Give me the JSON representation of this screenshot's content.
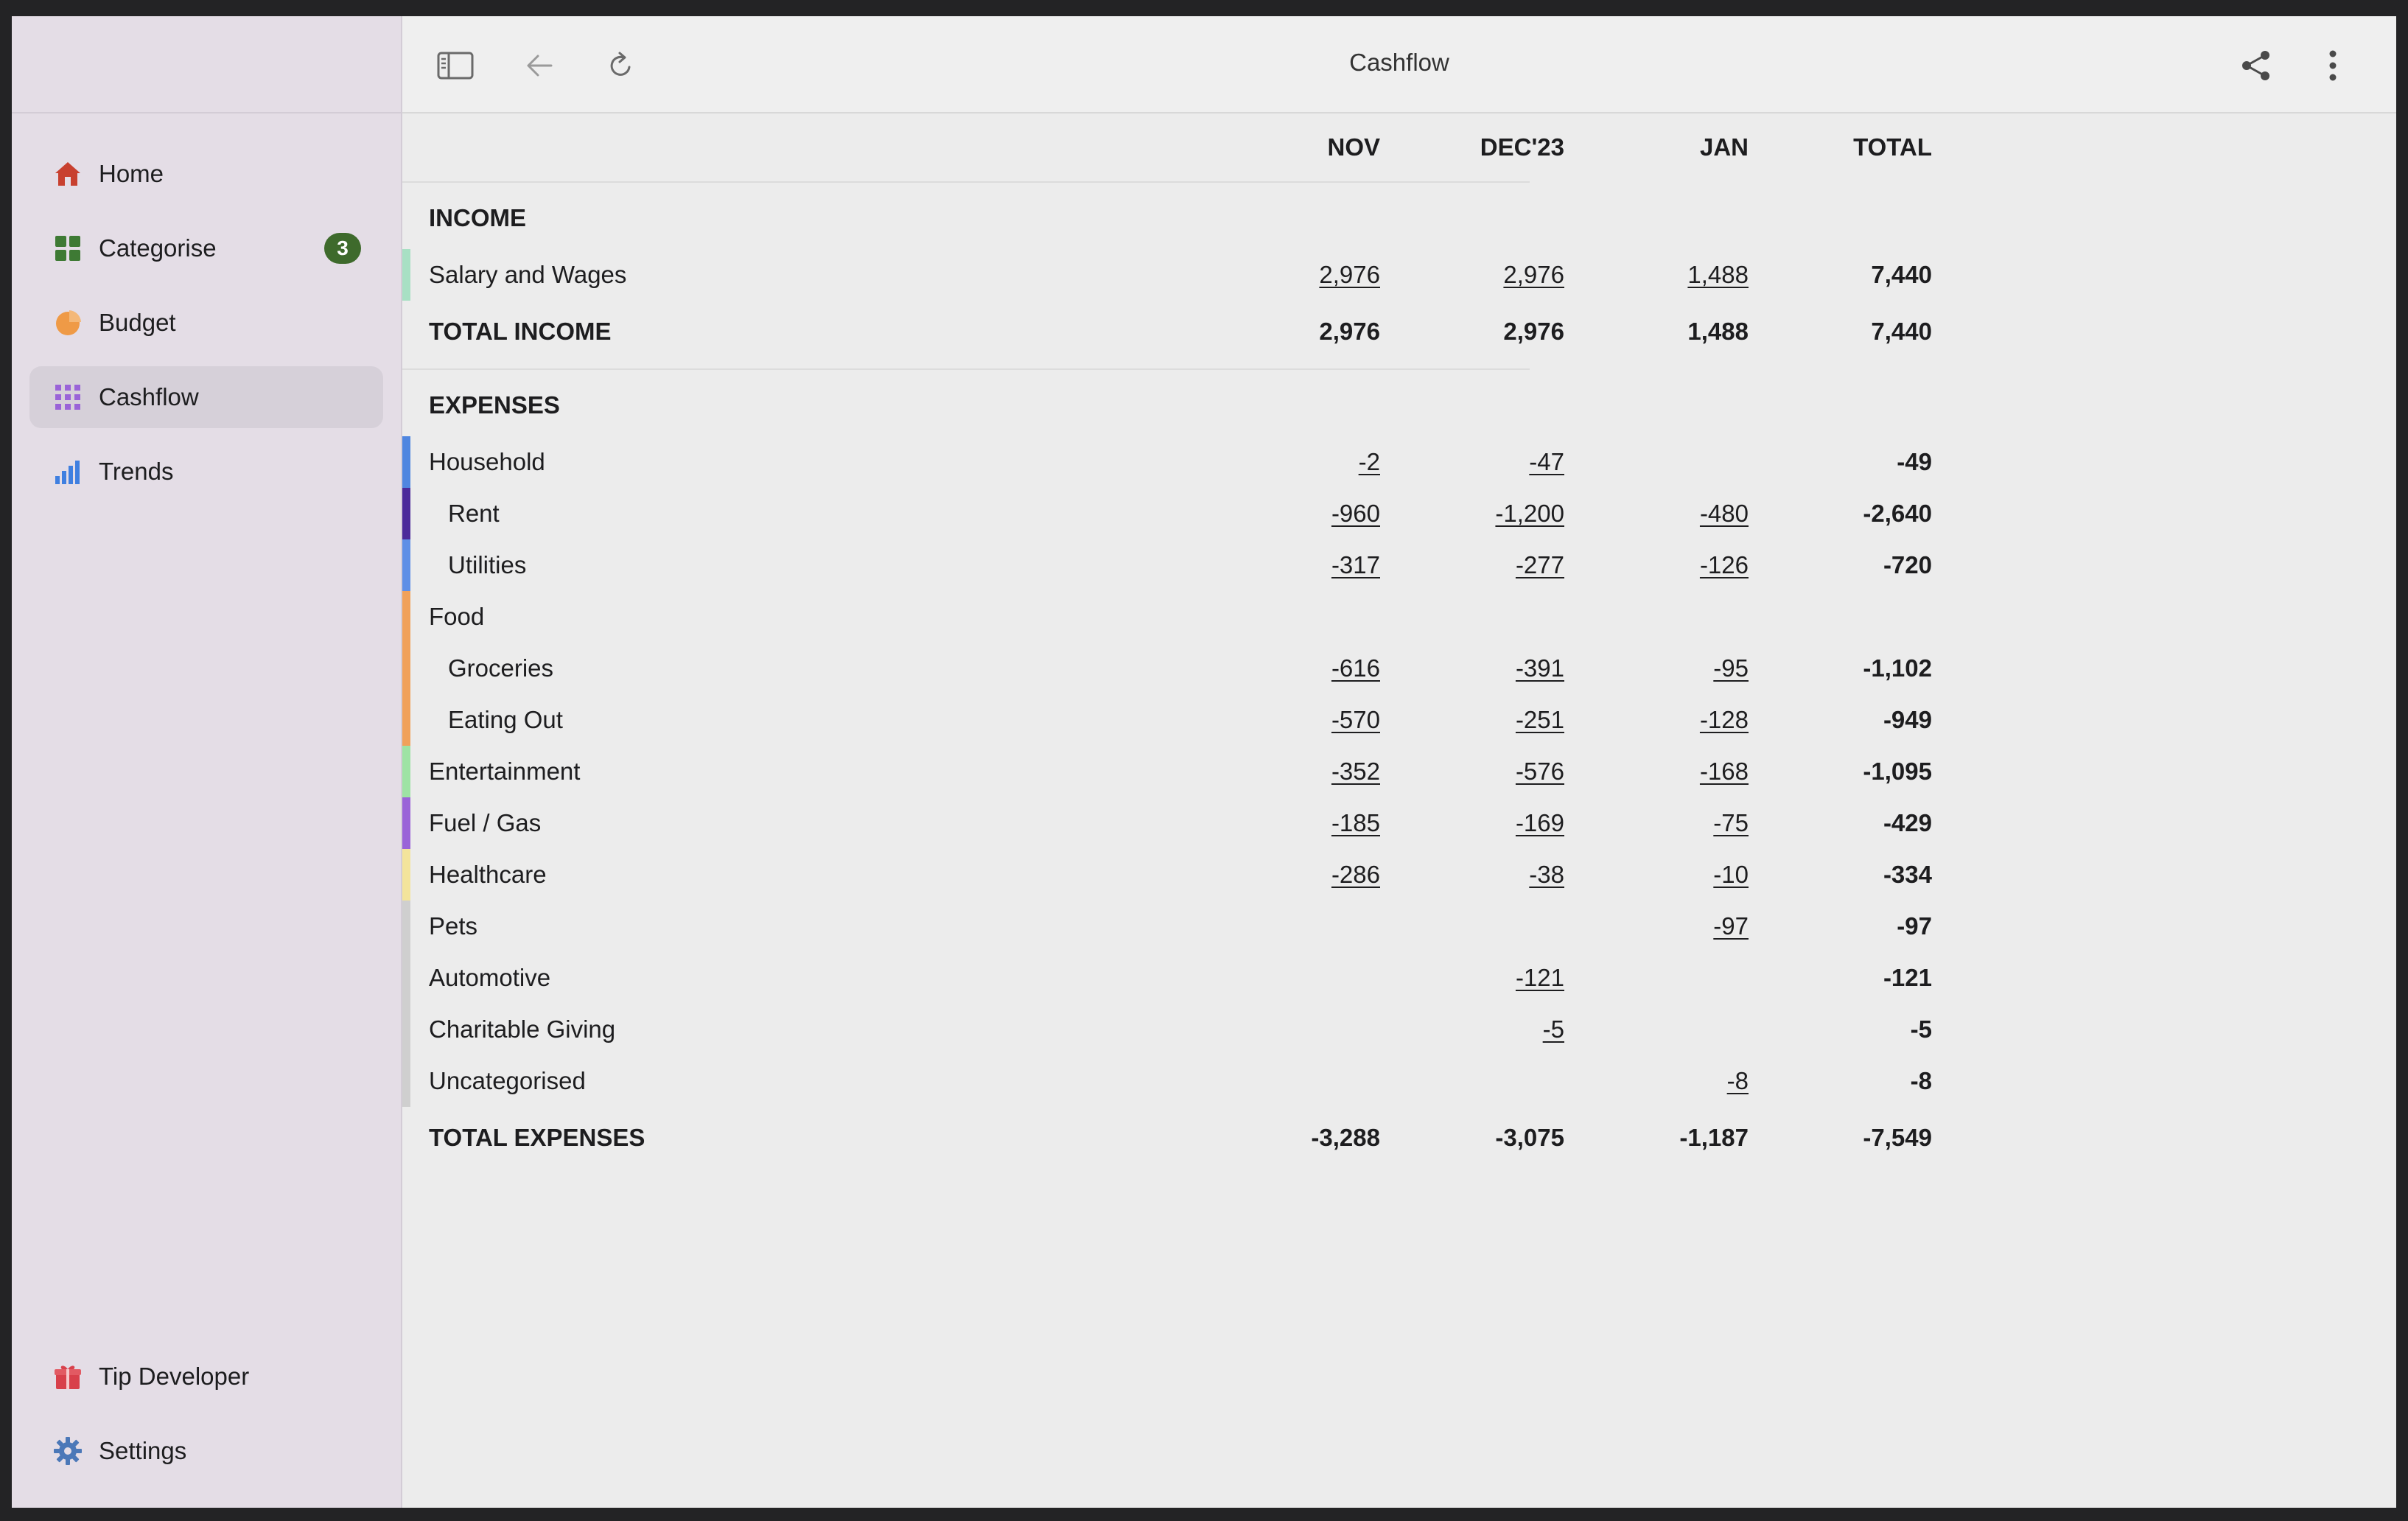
{
  "app": {
    "title": "Cashflow"
  },
  "sidebar": {
    "items": [
      {
        "label": "Home",
        "icon": "house-icon"
      },
      {
        "label": "Categorise",
        "icon": "grid-icon",
        "badge": "3"
      },
      {
        "label": "Budget",
        "icon": "pie-chart-icon"
      },
      {
        "label": "Cashflow",
        "icon": "dot-grid-icon",
        "active": true
      },
      {
        "label": "Trends",
        "icon": "bar-chart-icon"
      }
    ],
    "footer": [
      {
        "label": "Tip Developer",
        "icon": "gift-icon"
      },
      {
        "label": "Settings",
        "icon": "gear-icon"
      }
    ]
  },
  "table": {
    "columns": [
      "NOV",
      "DEC'23",
      "JAN",
      "TOTAL"
    ],
    "income_title": "INCOME",
    "income_rows": [
      {
        "label": "Salary and Wages",
        "values": [
          "2,976",
          "2,976",
          "1,488",
          "7,440"
        ],
        "color": "#a8e0c4"
      }
    ],
    "total_income": {
      "label": "TOTAL INCOME",
      "values": [
        "2,976",
        "2,976",
        "1,488",
        "7,440"
      ]
    },
    "expenses_title": "EXPENSES",
    "expense_rows": [
      {
        "label": "Household",
        "values": [
          "-2",
          "-47",
          "",
          "-49"
        ],
        "color": "#4f86e0"
      },
      {
        "label": "Rent",
        "values": [
          "-960",
          "-1,200",
          "-480",
          "-2,640"
        ],
        "color": "#4b2a9a",
        "sub": true
      },
      {
        "label": "Utilities",
        "values": [
          "-317",
          "-277",
          "-126",
          "-720"
        ],
        "color": "#5e8fe6",
        "sub": true
      },
      {
        "label": "Food",
        "values": [
          "",
          "",
          "",
          ""
        ],
        "color": "#f0a15a"
      },
      {
        "label": "Groceries",
        "values": [
          "-616",
          "-391",
          "-95",
          "-1,102"
        ],
        "color": "#f0a15a",
        "sub": true
      },
      {
        "label": "Eating Out",
        "values": [
          "-570",
          "-251",
          "-128",
          "-949"
        ],
        "color": "#f0a15a",
        "sub": true
      },
      {
        "label": "Entertainment",
        "values": [
          "-352",
          "-576",
          "-168",
          "-1,095"
        ],
        "color": "#9ee3a4"
      },
      {
        "label": "Fuel / Gas",
        "values": [
          "-185",
          "-169",
          "-75",
          "-429"
        ],
        "color": "#9a63d8"
      },
      {
        "label": "Healthcare",
        "values": [
          "-286",
          "-38",
          "-10",
          "-334"
        ],
        "color": "#f3e49b"
      },
      {
        "label": "Pets",
        "values": [
          "",
          "",
          "-97",
          "-97"
        ],
        "color": "#cfcfcf"
      },
      {
        "label": "Automotive",
        "values": [
          "",
          "-121",
          "",
          "-121"
        ],
        "color": "#cfcfcf"
      },
      {
        "label": "Charitable Giving",
        "values": [
          "",
          "-5",
          "",
          "-5"
        ],
        "color": "#cfcfcf"
      },
      {
        "label": "Uncategorised",
        "values": [
          "",
          "",
          "-8",
          "-8"
        ],
        "color": "#cfcfcf"
      }
    ],
    "total_expenses": {
      "label": "TOTAL EXPENSES",
      "values": [
        "-3,288",
        "-3,075",
        "-1,187",
        "-7,549"
      ]
    }
  },
  "colors": {
    "sidebar_bg": "#e4dde6",
    "active_bg": "#d6d0d9",
    "badge_bg": "#3e6a2c",
    "content_bg": "#ececec"
  }
}
